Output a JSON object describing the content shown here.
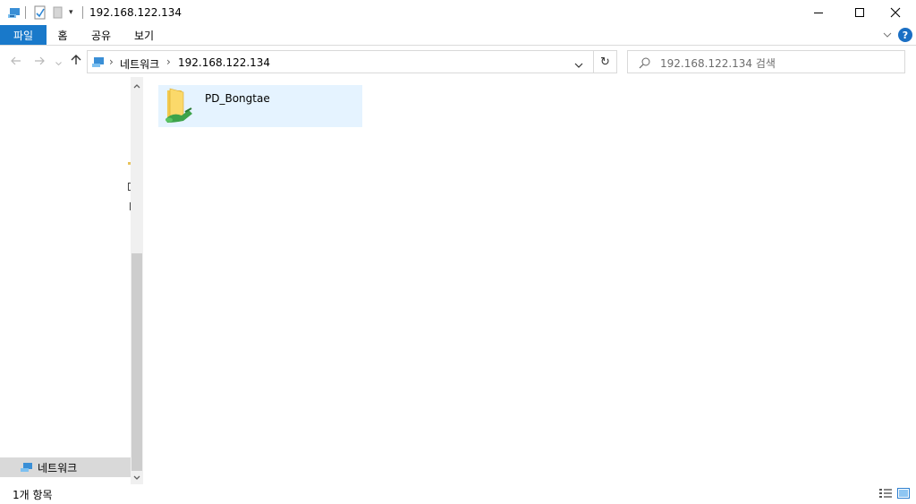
{
  "window": {
    "title": "192.168.122.134",
    "minimize_glyph": "—",
    "maximize_glyph": "☐",
    "close_glyph": "✕"
  },
  "ribbon": {
    "tabs": [
      "파일",
      "홈",
      "공유",
      "보기"
    ],
    "collapse_glyph": "⌄",
    "help_glyph": "?"
  },
  "address": {
    "breadcrumbs": [
      "네트워크",
      "192.168.122.134"
    ],
    "search_placeholder": "192.168.122.134 검색"
  },
  "nav_pane": {
    "items": [
      {
        "label": "네트워크",
        "icon": "network-icon",
        "selected": true
      }
    ]
  },
  "content": {
    "items": [
      {
        "name": "PD_Bongtae",
        "icon": "shared-folder-icon",
        "selected": true
      }
    ]
  },
  "status": {
    "item_count": "1개 항목"
  },
  "colors": {
    "accent": "#1979ca",
    "selection": "#e5f3ff",
    "nav_selection": "#d9d9d9"
  }
}
